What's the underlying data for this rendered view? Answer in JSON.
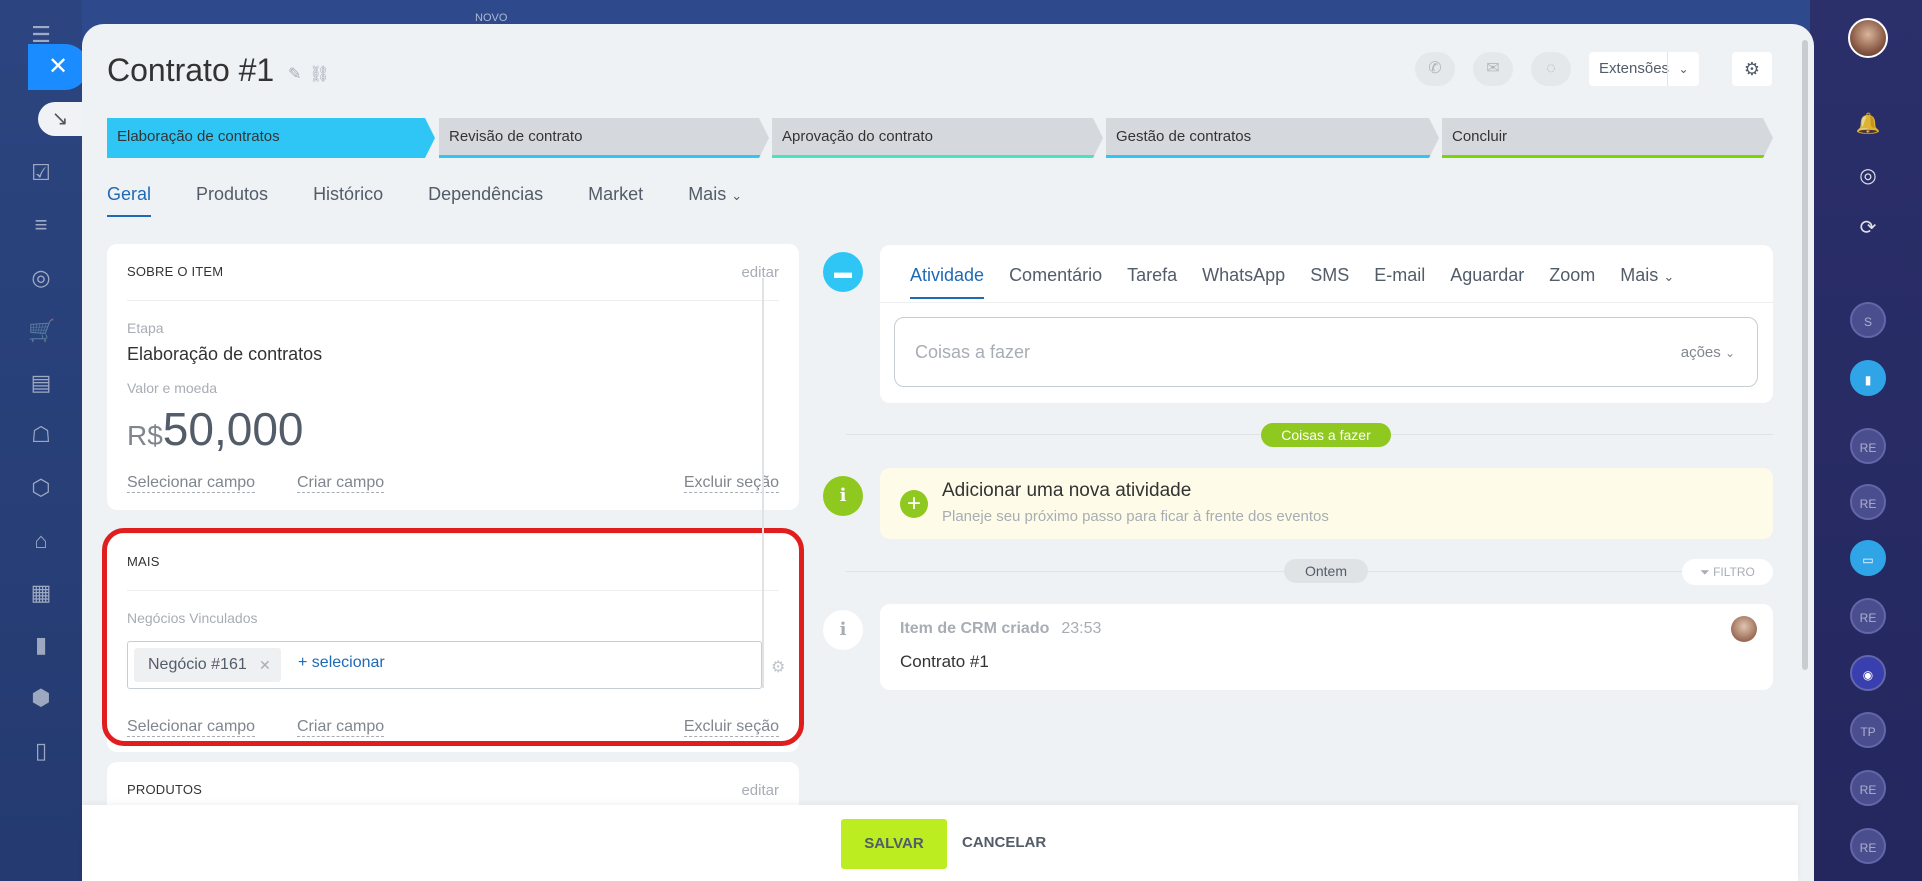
{
  "top_label": "NOVO",
  "title": "Contrato #1",
  "header": {
    "extensions_label": "Extensões"
  },
  "pipeline": [
    {
      "label": "Elaboração de contratos",
      "color": "#2fc6f6"
    },
    {
      "label": "Revisão de contrato",
      "color": "#55d0e0"
    },
    {
      "label": "Aprovação do contrato",
      "color": "#47e4c2"
    },
    {
      "label": "Gestão de contratos",
      "color": "#2fc6f6"
    },
    {
      "label": "Concluir",
      "color": "#7bd500"
    }
  ],
  "tabs": [
    "Geral",
    "Produtos",
    "Histórico",
    "Dependências",
    "Market",
    "Mais"
  ],
  "about": {
    "heading": "SOBRE O ITEM",
    "edit": "editar",
    "stage_label": "Etapa",
    "stage_value": "Elaboração de contratos",
    "amount_label": "Valor e moeda",
    "currency": "R$",
    "amount": "50,000",
    "select_field": "Selecionar campo",
    "create_field": "Criar campo",
    "delete_section": "Excluir seção"
  },
  "more": {
    "heading": "MAIS",
    "linked_label": "Negócios Vinculados",
    "tag": "Negócio #161",
    "add": "+ selecionar",
    "select_field": "Selecionar campo",
    "create_field": "Criar campo",
    "delete_section": "Excluir seção"
  },
  "products": {
    "heading": "PRODUTOS",
    "edit": "editar"
  },
  "activity": {
    "tabs": [
      "Atividade",
      "Comentário",
      "Tarefa",
      "WhatsApp",
      "SMS",
      "E-mail",
      "Aguardar",
      "Zoom",
      "Mais"
    ],
    "placeholder": "Coisas a fazer",
    "actions": "ações"
  },
  "timeline": {
    "todo_pill": "Coisas a fazer",
    "new_title": "Adicionar uma nova atividade",
    "new_sub": "Planeje seu próximo passo para ficar à frente dos eventos",
    "yesterday": "Ontem",
    "filter": "FILTRO",
    "crm_title": "Item de CRM criado",
    "crm_time": "23:53",
    "crm_body": "Contrato #1"
  },
  "right_rail": [
    "S",
    "RE",
    "RE",
    "RE",
    "TP",
    "RE",
    "RE"
  ],
  "footer": {
    "save": "SALVAR",
    "cancel": "CANCELAR"
  }
}
